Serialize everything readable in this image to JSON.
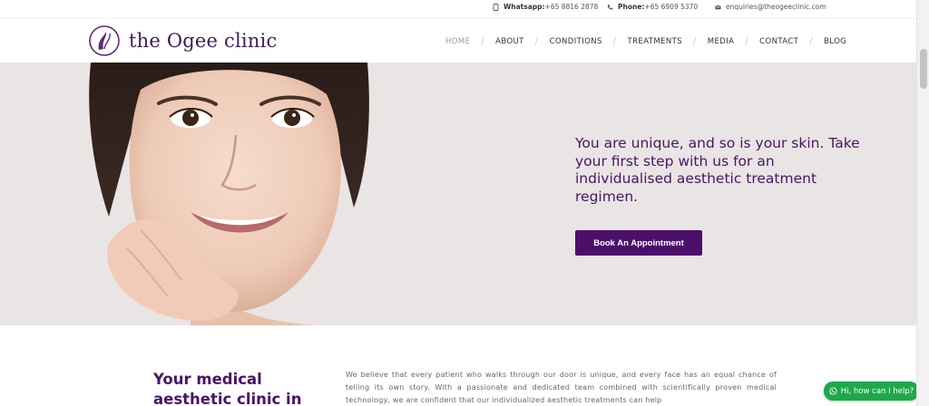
{
  "topbar": {
    "whatsapp_label": "Whatsapp:",
    "whatsapp_value": "+65 8816 2878",
    "phone_label": "Phone:",
    "phone_value": "+65 6909 5370",
    "email": "enquiries@theogeeclinic.com"
  },
  "brand": {
    "name": "the Ogee clinic"
  },
  "nav": [
    {
      "label": "HOME",
      "active": true
    },
    {
      "label": "ABOUT"
    },
    {
      "label": "CONDITIONS"
    },
    {
      "label": "TREATMENTS"
    },
    {
      "label": "MEDIA"
    },
    {
      "label": "CONTACT"
    },
    {
      "label": "BLOG"
    }
  ],
  "hero": {
    "headline": "You are unique, and so is your skin. Take your first step with us for an individualised aesthetic treatment regimen.",
    "cta": "Book An Appointment"
  },
  "intro": {
    "title": "Your medical aesthetic clinic in",
    "body": "We believe that every patient who walks through our door is unique, and every face has an equal chance of telling its own story. With a passionate and dedicated team combined with scientifically proven medical technology, we are confident that our individualized aesthetic treatments can help"
  },
  "chat": {
    "label": "Hi, how can I help?"
  },
  "colors": {
    "brand_purple": "#4b0f6b",
    "whatsapp_green": "#1fa84a",
    "hero_bg": "#e9e5e4"
  }
}
